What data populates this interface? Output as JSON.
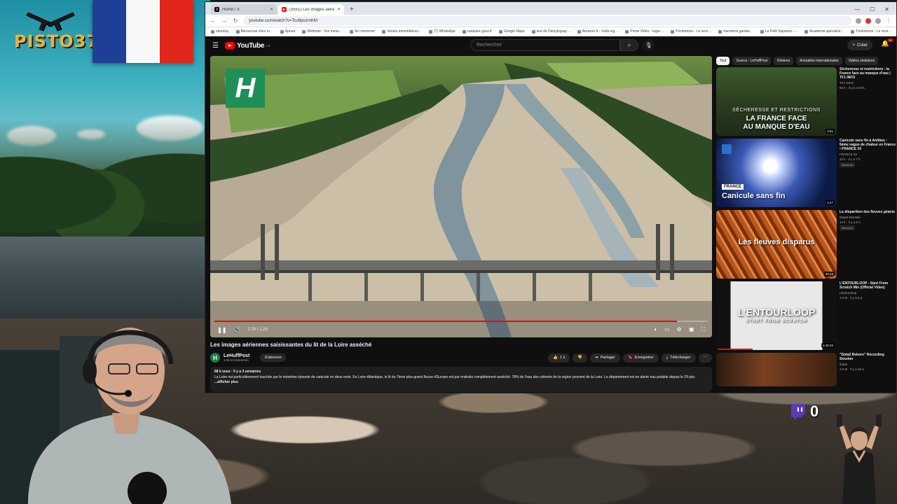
{
  "browser": {
    "tabs": [
      {
        "label": "Home / X",
        "icon": "x-icon",
        "active": false
      },
      {
        "label": "(3551) Les images aérienn…",
        "icon": "youtube-icon",
        "active": true
      }
    ],
    "url": "youtube.com/watch?v=Tcu9pozmKM",
    "bookmarks": [
      "ebooksy",
      "Bienvenue chez m…",
      "Apnea",
      "Webmail - Vos mess…",
      "Se connecter",
      "Ventes immobilières…",
      "(7) WhatsApp",
      "cadastre.gouv.fr",
      "Google Maps",
      "test de Dactylograp…",
      "Amazon.fr - Voilà mg…",
      "Prime Video : regar…",
      "Pocketmon - Le reve…",
      "transferts gardes…",
      "Le Petit Vapoteur -…",
      "Académie spécialist…",
      "Pocketmon - Le reve…"
    ]
  },
  "youtube": {
    "logo": "YouTube",
    "country": "FR",
    "search_placeholder": "Rechercher",
    "create_label": "Créer",
    "notif_count": "9+",
    "video": {
      "time": "1:20 / 1:28",
      "progress": 0.938,
      "title": "Les images aériennes saisissantes du lit de la Loire asséché",
      "channel": "LeHuffPost",
      "channel_initial": "H",
      "subs": "1,55 M d'abonnés",
      "subscribe": "S'abonner",
      "likes": "1 k",
      "share": "Partager",
      "save": "Enregistrer",
      "download": "Télécharger",
      "stats": "68 k vues · Il y a 3 semaines",
      "description": "La Loire est particulièrement touchée par le troisième épisode de canicule en deux mois. En Loire-Atlantique, le lit du 7ème plus grand fleuve d'Europe est par endroits complètement asséché. 78% de l'eau des robinets de la région provient de la Loire. Le département est en alerte eau potable depuis le 29 juin.",
      "more": "...afficher plus",
      "logo_letter": "H"
    },
    "chips": [
      "Tout",
      "Source : LeHuffPost",
      "Rivières",
      "Actualités internationales",
      "Vidéos similaires"
    ],
    "recommendations": [
      {
        "title": "Sécheresse et restrictions : la France face au manque d'eau | TF1 INFO",
        "channel": "TF1 INFO",
        "views": "85 k · Il y a 3 sem.",
        "duration": "4:51",
        "thumb_text": [
          "SÉCHERESSE ET RESTRICTIONS",
          "LA FRANCE FACE",
          "AU MANQUE D'EAU"
        ]
      },
      {
        "title": "Canicule sans fin à Antibes : 5ème vague de chaleur en France • FRANCE 24",
        "channel": "FRANCE 24",
        "views": "10 k · Il y a 7 h",
        "duration": "1:47",
        "badge": "Nouveau",
        "thumb_tag": "FRANCE",
        "thumb_text": [
          "Canicule sans fin"
        ]
      },
      {
        "title": "La disparition des fleuves géants",
        "channel": "Baladi Montale",
        "views": "14 k · Il y a 5 h",
        "duration": "34:13",
        "badge": "Nouveau",
        "thumb_text": [
          "Les fleuves disparus"
        ]
      },
      {
        "title": "L'ENTOURLOOP - Start From Scratch Mix (Official Video)",
        "channel": "LEntourloop",
        "views": "4,8 M · Il y a 5 a",
        "duration": "1:16:42",
        "thumb_text": [
          "L'ENTOURLOOP",
          "START FROM SCRATCH"
        ]
      },
      {
        "title": "\"Dota2 Reborn\" Recording Session",
        "channel": "dota2",
        "views": "4,5 M · Il y a 10 a",
        "duration": "",
        "thumb_text": []
      }
    ]
  },
  "overlay": {
    "streamer_logo": "PISTO37",
    "counter": "0",
    "flag_colors": [
      "#1f3f97",
      "#f7f7f7",
      "#e1261c"
    ]
  }
}
